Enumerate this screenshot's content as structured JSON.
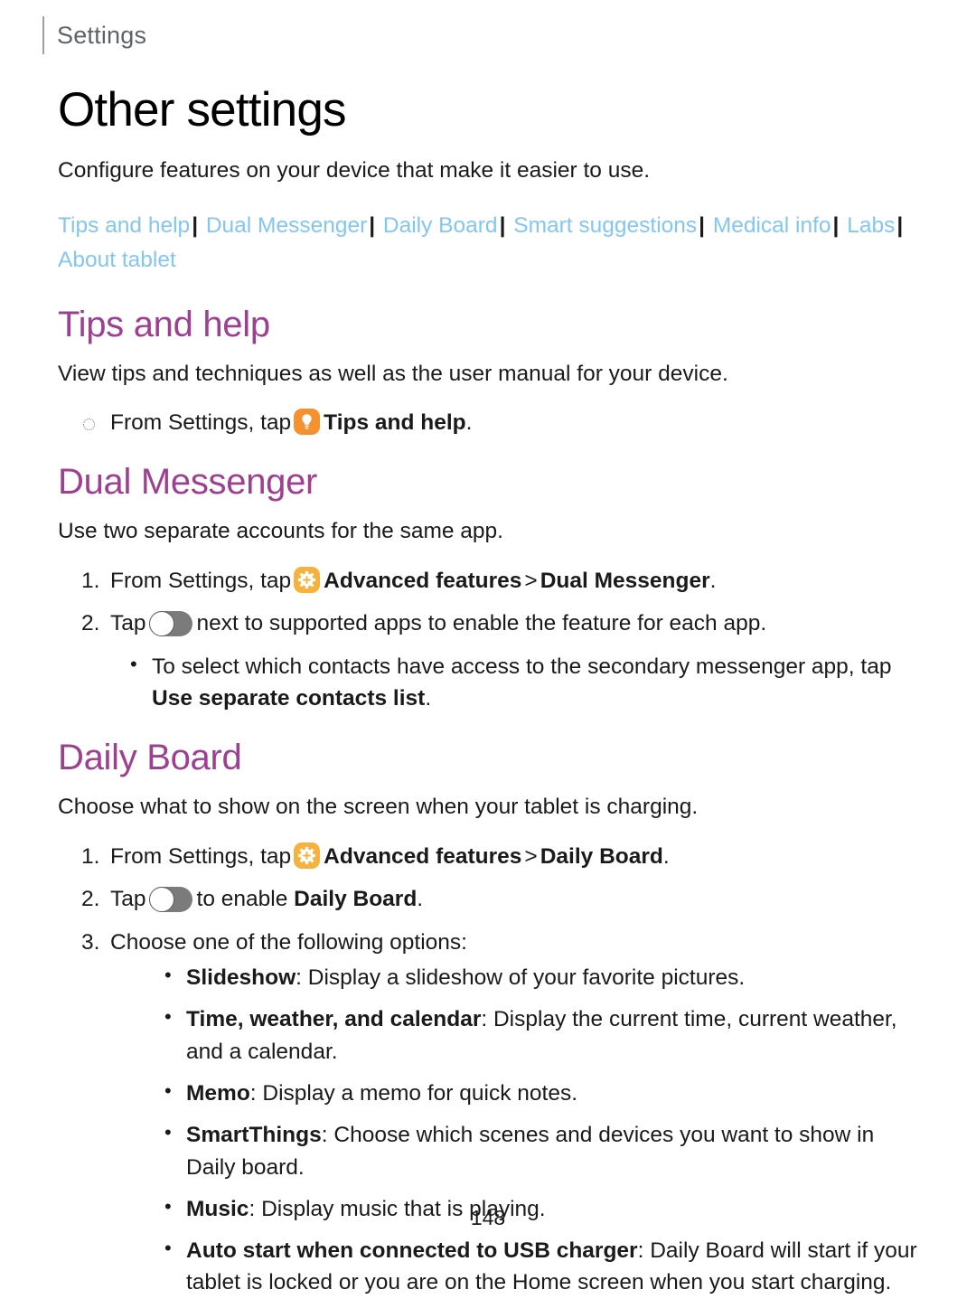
{
  "header": {
    "running_title": "Settings"
  },
  "page_title": "Other settings",
  "intro": "Configure features on your device that make it easier to use.",
  "nav_links": [
    "Tips and help",
    "Dual Messenger",
    "Daily Board",
    "Smart suggestions",
    "Medical info",
    "Labs",
    "About tablet"
  ],
  "nav_separator": "|",
  "sections": {
    "tips_and_help": {
      "heading": "Tips and help",
      "description": "View tips and techniques as well as the user manual for your device.",
      "step_1_pre": "From Settings, tap",
      "step_1_bold": "Tips and help",
      "step_1_post": "."
    },
    "dual_messenger": {
      "heading": "Dual Messenger",
      "description": "Use two separate accounts for the same app.",
      "step_1_pre": "From Settings, tap",
      "step_1_bold_a": "Advanced features",
      "step_1_chevron": ">",
      "step_1_bold_b": "Dual Messenger",
      "step_1_post": ".",
      "step_2_pre": "Tap",
      "step_2_post": "next to supported apps to enable the feature for each app.",
      "sub_bullet_pre": "To select which contacts have access to the secondary messenger app, tap",
      "sub_bullet_bold": "Use separate contacts list",
      "sub_bullet_post": "."
    },
    "daily_board": {
      "heading": "Daily Board",
      "description": "Choose what to show on the screen when your tablet is charging.",
      "step_1_pre": "From Settings, tap",
      "step_1_bold_a": "Advanced features",
      "step_1_chevron": ">",
      "step_1_bold_b": "Daily Board",
      "step_1_post": ".",
      "step_2_pre": "Tap",
      "step_2_mid": "to enable",
      "step_2_bold": "Daily Board",
      "step_2_post": ".",
      "step_3": "Choose one of the following options:",
      "options": [
        {
          "label": "Slideshow",
          "separator": ":",
          "text": "Display a slideshow of your favorite pictures."
        },
        {
          "label": "Time, weather, and calendar",
          "separator": ":",
          "text": "Display the current time, current weather, and a calendar."
        },
        {
          "label": "Memo",
          "separator": ":",
          "text": "Display a memo for quick notes."
        },
        {
          "label": "SmartThings",
          "separator": ":",
          "text": "Choose which scenes and devices you want to show in Daily board."
        },
        {
          "label": "Music",
          "separator": ":",
          "text": "Display music that is playing."
        },
        {
          "label": "Auto start when connected to USB charger",
          "separator": ":",
          "text": "Daily Board will start if your tablet is locked or you are on the Home screen when you start charging."
        }
      ]
    }
  },
  "icons": {
    "tips_bulb": "lightbulb-icon",
    "advanced_features_gear": "gear-icon",
    "toggle": "toggle-switch-off"
  },
  "colors": {
    "heading_purple": "#9e3f91",
    "link_blue": "#82c6f2",
    "tips_icon_orange": "#f5922f",
    "gear_icon_amber": "#f6b23c",
    "toggle_track_gray": "#7b7b7b",
    "running_header_gray": "#5f6368"
  },
  "page_number": "148"
}
